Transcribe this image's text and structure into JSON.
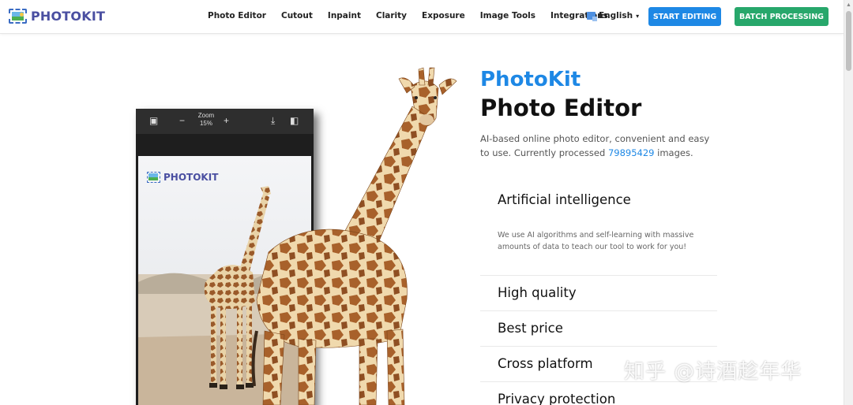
{
  "brand": {
    "name": "PHOTOKIT"
  },
  "nav": {
    "items": [
      "Photo Editor",
      "Cutout",
      "Inpaint",
      "Clarity",
      "Exposure",
      "Image Tools",
      "Integrations"
    ],
    "language": "English",
    "start_label": "START EDITING",
    "batch_label": "BATCH PROCESSING"
  },
  "editor": {
    "zoom_label": "Zoom",
    "zoom_value": "15%",
    "preview_brand": "PHOTOKIT"
  },
  "hero": {
    "title_line1": "PhotoKit",
    "title_line2": "Photo Editor",
    "desc_before": "AI-based online photo editor, convenient and easy to use. Currently processed ",
    "desc_count": "79895429",
    "desc_after": " images."
  },
  "features": [
    {
      "title": "Artificial intelligence",
      "text": "We use AI algorithms and self-learning with massive amounts of data to teach our tool to work for you!"
    },
    {
      "title": "High quality"
    },
    {
      "title": "Best price"
    },
    {
      "title": "Cross platform"
    },
    {
      "title": "Privacy protection"
    }
  ],
  "watermark": "知乎 @诗酒趁年华",
  "colors": {
    "accent": "#1e88e5",
    "batch": "#27a76b",
    "brand": "#4a4fa1"
  }
}
